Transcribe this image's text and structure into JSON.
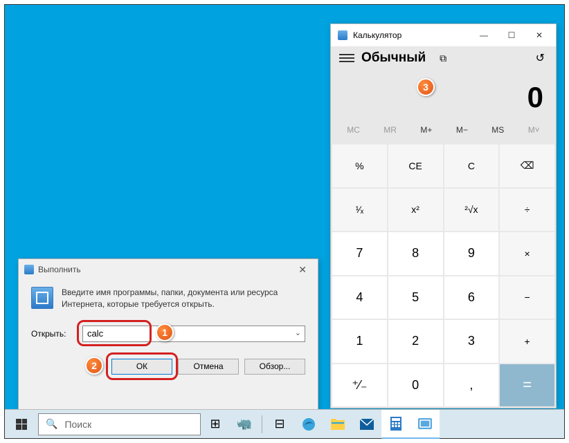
{
  "run": {
    "title": "Выполнить",
    "instruction": "Введите имя программы, папки, документа или ресурса Интернета, которые требуется открыть.",
    "label": "Открыть:",
    "value": "calc",
    "ok": "ОК",
    "cancel": "Отмена",
    "browse": "Обзор..."
  },
  "calc": {
    "title": "Калькулятор",
    "mode": "Обычный",
    "display": "0",
    "mem": {
      "mc": "MC",
      "mr": "MR",
      "mplus": "M+",
      "mminus": "M−",
      "ms": "MS",
      "mv": "M˅"
    },
    "keys": {
      "percent": "%",
      "ce": "CE",
      "c": "C",
      "back": "⌫",
      "inv": "¹⁄ₓ",
      "sq": "x²",
      "sqrt": "²√x",
      "div": "÷",
      "k7": "7",
      "k8": "8",
      "k9": "9",
      "mul": "×",
      "k4": "4",
      "k5": "5",
      "k6": "6",
      "sub": "−",
      "k1": "1",
      "k2": "2",
      "k3": "3",
      "add": "+",
      "neg": "⁺⁄₋",
      "k0": "0",
      "dot": ",",
      "eq": "="
    }
  },
  "taskbar": {
    "search": "Поиск"
  },
  "badges": {
    "b1": "1",
    "b2": "2",
    "b3": "3"
  }
}
